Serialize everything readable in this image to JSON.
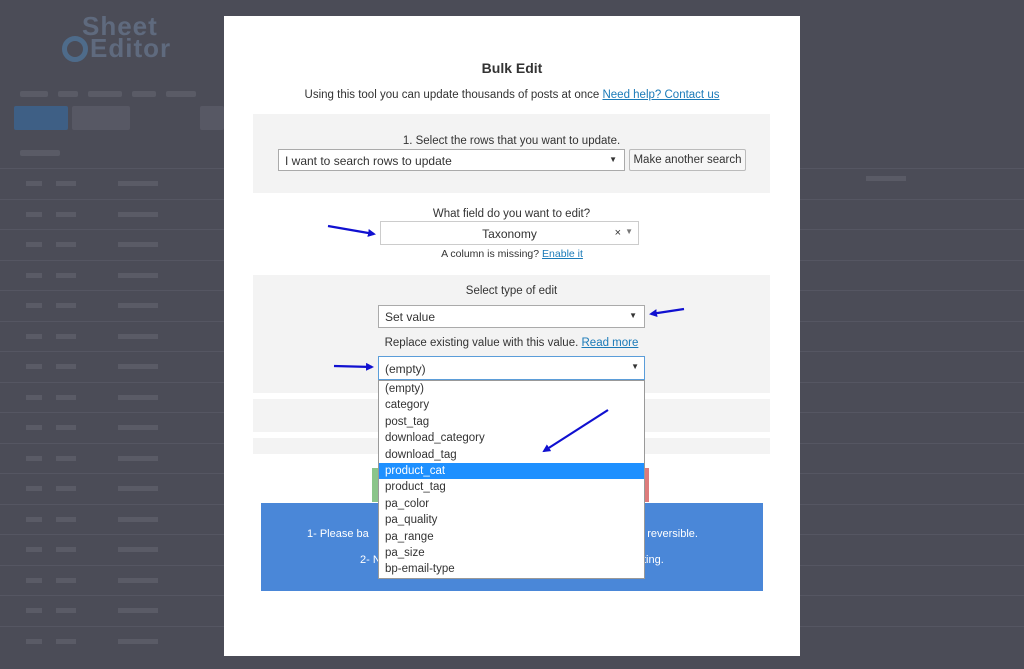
{
  "background": {
    "logo_text_line1": "Sheet",
    "logo_text_line2": "Editor"
  },
  "modal": {
    "title": "Bulk Edit",
    "subtitle": "Using this tool you can update thousands of posts at once",
    "help_link": "Need help? Contact us",
    "rows_label": "1. Select the rows that you want to update.",
    "rows_select_value": "I want to search rows to update",
    "another_search_button": "Make another search",
    "field_label": "What field do you want to edit?",
    "field_value": "Taxonomy",
    "field_clear": "×",
    "missing_note": "A column is missing?",
    "enable_link": "Enable it",
    "edit_type_label": "Select type of edit",
    "edit_type_value": "Set value",
    "replace_note": "Replace existing value with this value.",
    "read_more_link": "Read more",
    "value_select": "(empty)",
    "value_options": [
      "(empty)",
      "category",
      "post_tag",
      "download_category",
      "download_tag",
      "product_cat",
      "product_tag",
      "pa_color",
      "pa_quality",
      "pa_range",
      "pa_size",
      "bp-email-type"
    ],
    "selected_option_index": 5,
    "warning_line1_left": "1- Please ba",
    "warning_line1_right": "ot reversible.",
    "warning_line2_left": "2- N",
    "warning_line2_right": "ting."
  },
  "colors": {
    "overlay": "#4b4c57",
    "modal_bg": "#ffffff",
    "section_bg": "#f3f3f3",
    "link": "#1a7ab8",
    "highlight": "#1e90ff",
    "warning_bg": "#4a87d8",
    "arrow": "#1010d0"
  }
}
